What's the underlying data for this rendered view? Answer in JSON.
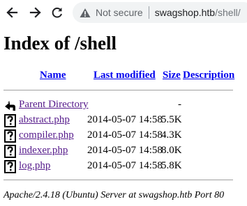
{
  "browser": {
    "back_icon": "back-arrow-icon",
    "forward_icon": "forward-arrow-icon",
    "reload_icon": "reload-icon",
    "warning_icon": "warning-triangle-icon",
    "security_label": "Not secure",
    "url_host": "swagshop.htb",
    "url_path": "/shell/"
  },
  "page": {
    "title": "Index of /shell",
    "columns": {
      "name": "Name",
      "last_modified": "Last modified",
      "size": "Size",
      "description": "Description"
    },
    "parent": {
      "label": "Parent Directory",
      "size": "-",
      "icon": "back-folder-icon"
    },
    "files": [
      {
        "name": "abstract.php",
        "modified": "2014-05-07 14:58",
        "size": "5.5K",
        "icon": "unknown-file-icon"
      },
      {
        "name": "compiler.php",
        "modified": "2014-05-07 14:58",
        "size": "4.3K",
        "icon": "unknown-file-icon"
      },
      {
        "name": "indexer.php",
        "modified": "2014-05-07 14:58",
        "size": "8.0K",
        "icon": "unknown-file-icon"
      },
      {
        "name": "log.php",
        "modified": "2014-05-07 14:58",
        "size": "5.8K",
        "icon": "unknown-file-icon"
      }
    ],
    "footer": "Apache/2.4.18 (Ubuntu) Server at swagshop.htb Port 80"
  },
  "colors": {
    "link": "#0000ee",
    "visited_link": "#551a8b",
    "omnibox_bg": "#f1f3f4"
  }
}
